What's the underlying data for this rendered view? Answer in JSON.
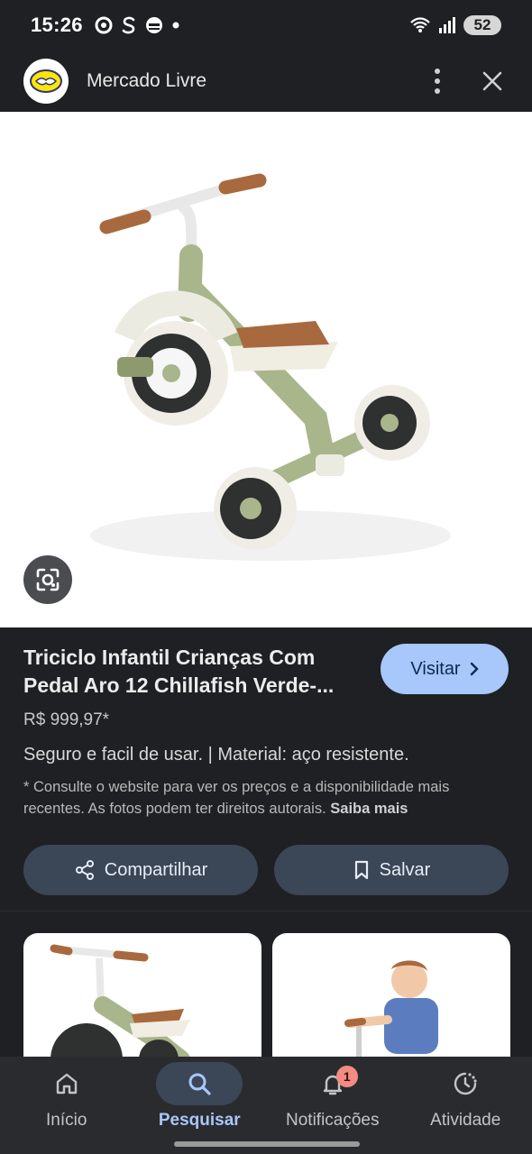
{
  "status_bar": {
    "time": "15:26",
    "battery": "52",
    "left_icons": [
      "media-icon",
      "s-app-icon",
      "e-app-icon",
      "dot-icon"
    ],
    "right_icons": [
      "wifi-icon",
      "signal-icon"
    ]
  },
  "header": {
    "site_name": "Mercado Livre",
    "logo_icon": "handshake-logo",
    "menu_icon": "more-vert-icon",
    "close_icon": "close-icon"
  },
  "product": {
    "title": "Triciclo Infantil Crianças Com Pedal Aro 12 Chillafish Verde-...",
    "price": "R$ 999,97*",
    "description": "Seguro e facil de usar. | Material: aço resistente.",
    "disclaimer": "* Consulte o website para ver os preços e a disponibilidade mais recentes. As fotos podem ter direitos autorais.",
    "learn_more": "Saiba mais",
    "visit_label": "Visitar"
  },
  "actions": {
    "share_label": "Compartilhar",
    "save_label": "Salvar"
  },
  "bottom_nav": {
    "items": [
      {
        "label": "Início",
        "icon": "home-icon",
        "active": false
      },
      {
        "label": "Pesquisar",
        "icon": "search-icon",
        "active": true
      },
      {
        "label": "Notificações",
        "icon": "bell-icon",
        "active": false,
        "badge": "1"
      },
      {
        "label": "Atividade",
        "icon": "activity-icon",
        "active": false
      }
    ]
  },
  "colors": {
    "background": "#1f2023",
    "accent": "#a8c7fa",
    "button_bg": "#3b4657",
    "tricycle_frame": "#a9b58a",
    "seat": "#a8693e"
  }
}
